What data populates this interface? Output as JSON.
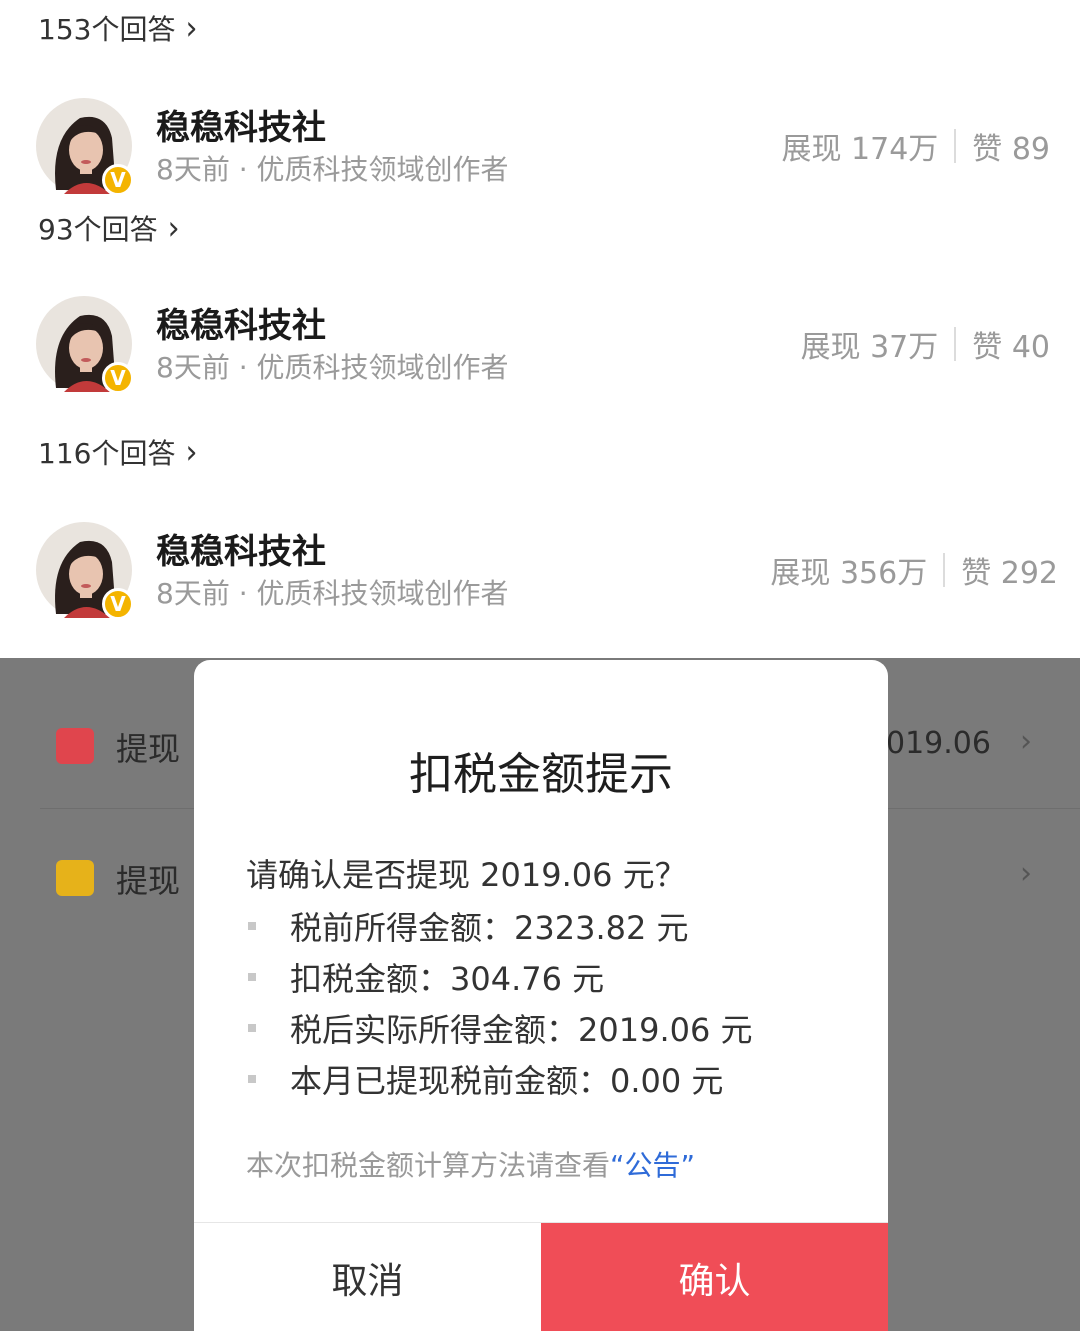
{
  "feed": {
    "items": [
      {
        "answers_label": "153个回答",
        "author": {
          "name": "稳稳科技社",
          "meta": "8天前 · 优质科技领域创作者"
        },
        "stats": {
          "views": "展现 174万",
          "likes": "赞 89"
        }
      },
      {
        "answers_label": "93个回答",
        "author": {
          "name": "稳稳科技社",
          "meta": "8天前 · 优质科技领域创作者"
        },
        "stats": {
          "views": "展现 37万",
          "likes": "赞 40"
        }
      },
      {
        "answers_label": "116个回答",
        "author": {
          "name": "稳稳科技社",
          "meta": "8天前 · 优质科技领域创作者"
        },
        "stats": {
          "views": "展现 356万",
          "likes": "赞 292"
        }
      }
    ],
    "verified_badge": "V",
    "chevron_icon": "chevron-right-icon"
  },
  "background": {
    "rows": [
      {
        "label": "提现",
        "value": "019.06",
        "icon": "wallet-icon",
        "icon_color": "#e0454d"
      },
      {
        "label": "提现",
        "value": "",
        "icon": "record-icon",
        "icon_color": "#e6b21a"
      }
    ]
  },
  "dialog": {
    "title": "扣税金额提示",
    "question": "请确认是否提现 2019.06 元？",
    "items": [
      "税前所得金额：2323.82 元",
      "扣税金额：304.76 元",
      "税后实际所得金额：2019.06 元",
      "本月已提现税前金额：0.00 元"
    ],
    "note_prefix": "本次扣税金额计算方法请查看",
    "note_link": "“公告”",
    "cancel_label": "取消",
    "confirm_label": "确认",
    "confirm_color": "#f04d57"
  }
}
